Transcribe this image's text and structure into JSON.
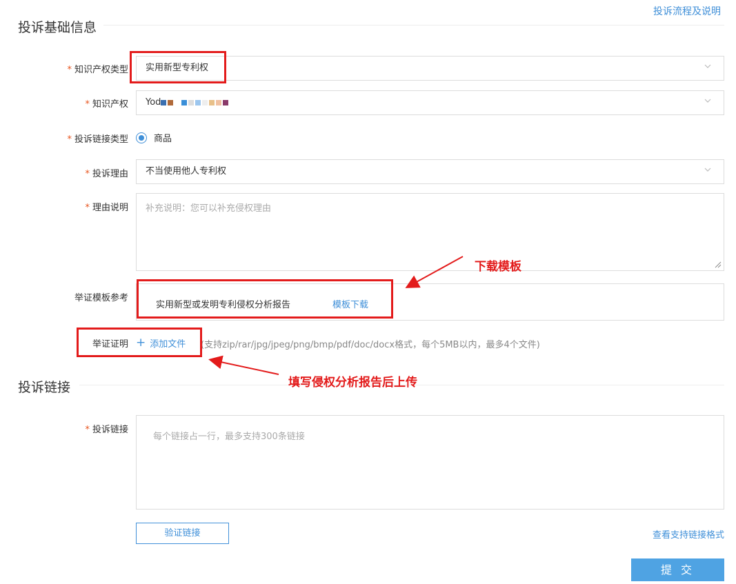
{
  "top_link": "投诉流程及说明",
  "basic_section": {
    "title": "投诉基础信息",
    "ip_type": {
      "label": "知识产权类型",
      "value": "实用新型专利权"
    },
    "ip": {
      "label": "知识产权",
      "value": "Yod"
    },
    "link_type": {
      "label": "投诉链接类型",
      "option": "商品"
    },
    "reason": {
      "label": "投诉理由",
      "value": "不当使用他人专利权"
    },
    "reason_desc": {
      "label": "理由说明",
      "placeholder": "补充说明：您可以补充侵权理由"
    },
    "template": {
      "label": "举证模板参考",
      "name": "实用新型或发明专利侵权分析报告",
      "download": "模板下载"
    },
    "evidence": {
      "label": "举证证明",
      "add": "添加文件",
      "hint": "(支持zip/rar/jpg/jpeg/png/bmp/pdf/doc/docx格式，每个5MB以内，最多4个文件)"
    }
  },
  "link_section": {
    "title": "投诉链接",
    "links": {
      "label": "投诉链接",
      "placeholder": "每个链接占一行，最多支持300条链接"
    },
    "verify_button": "验证链接",
    "format_link": "查看支持链接格式",
    "submit_button": "提 交"
  },
  "annotations": {
    "download_template": "下载模板",
    "upload_after_fill": "填写侵权分析报告后上传"
  },
  "colors": {
    "accent": "#3f8fd8",
    "required": "#e8541e",
    "annotation": "#e31b1b",
    "submit": "#4fa3e3"
  }
}
